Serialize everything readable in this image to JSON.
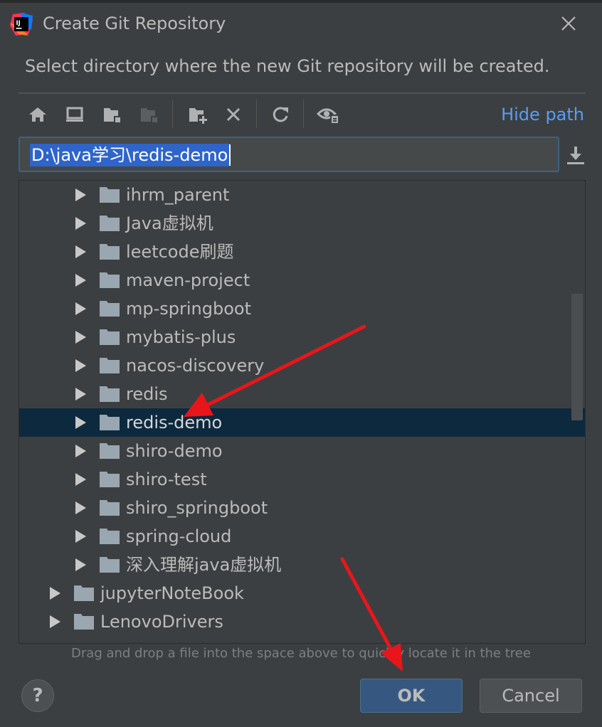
{
  "window": {
    "title": "Create Git Repository",
    "description": "Select directory where the new Git repository will be created."
  },
  "toolbar": {
    "icons": [
      "home-icon",
      "desktop-icon",
      "project-folder-icon",
      "module-folder-icon",
      "new-folder-icon",
      "delete-icon",
      "refresh-icon",
      "show-hidden-icon"
    ],
    "hide_path_label": "Hide path"
  },
  "path_field": {
    "value": "D:\\java学习\\redis-demo"
  },
  "tree": {
    "items": [
      {
        "label": "ihrm_parent",
        "level": 2,
        "selected": false
      },
      {
        "label": "Java虚拟机",
        "level": 2,
        "selected": false
      },
      {
        "label": "leetcode刷题",
        "level": 2,
        "selected": false
      },
      {
        "label": "maven-project",
        "level": 2,
        "selected": false
      },
      {
        "label": "mp-springboot",
        "level": 2,
        "selected": false
      },
      {
        "label": "mybatis-plus",
        "level": 2,
        "selected": false
      },
      {
        "label": "nacos-discovery",
        "level": 2,
        "selected": false
      },
      {
        "label": "redis",
        "level": 2,
        "selected": false
      },
      {
        "label": "redis-demo",
        "level": 2,
        "selected": true
      },
      {
        "label": "shiro-demo",
        "level": 2,
        "selected": false
      },
      {
        "label": "shiro-test",
        "level": 2,
        "selected": false
      },
      {
        "label": "shiro_springboot",
        "level": 2,
        "selected": false
      },
      {
        "label": "spring-cloud",
        "level": 2,
        "selected": false
      },
      {
        "label": "深入理解java虚拟机",
        "level": 2,
        "selected": false
      },
      {
        "label": "jupyterNoteBook",
        "level": 1,
        "selected": false
      },
      {
        "label": "LenovoDrivers",
        "level": 1,
        "selected": false
      }
    ]
  },
  "hint": "Drag and drop a file into the space above to quickly locate it in the tree",
  "buttons": {
    "help": "?",
    "ok": "OK",
    "cancel": "Cancel"
  },
  "colors": {
    "background": "#3c3f41",
    "selection": "#0d293e",
    "link": "#589df6",
    "annotation_arrow": "#e8161b"
  }
}
